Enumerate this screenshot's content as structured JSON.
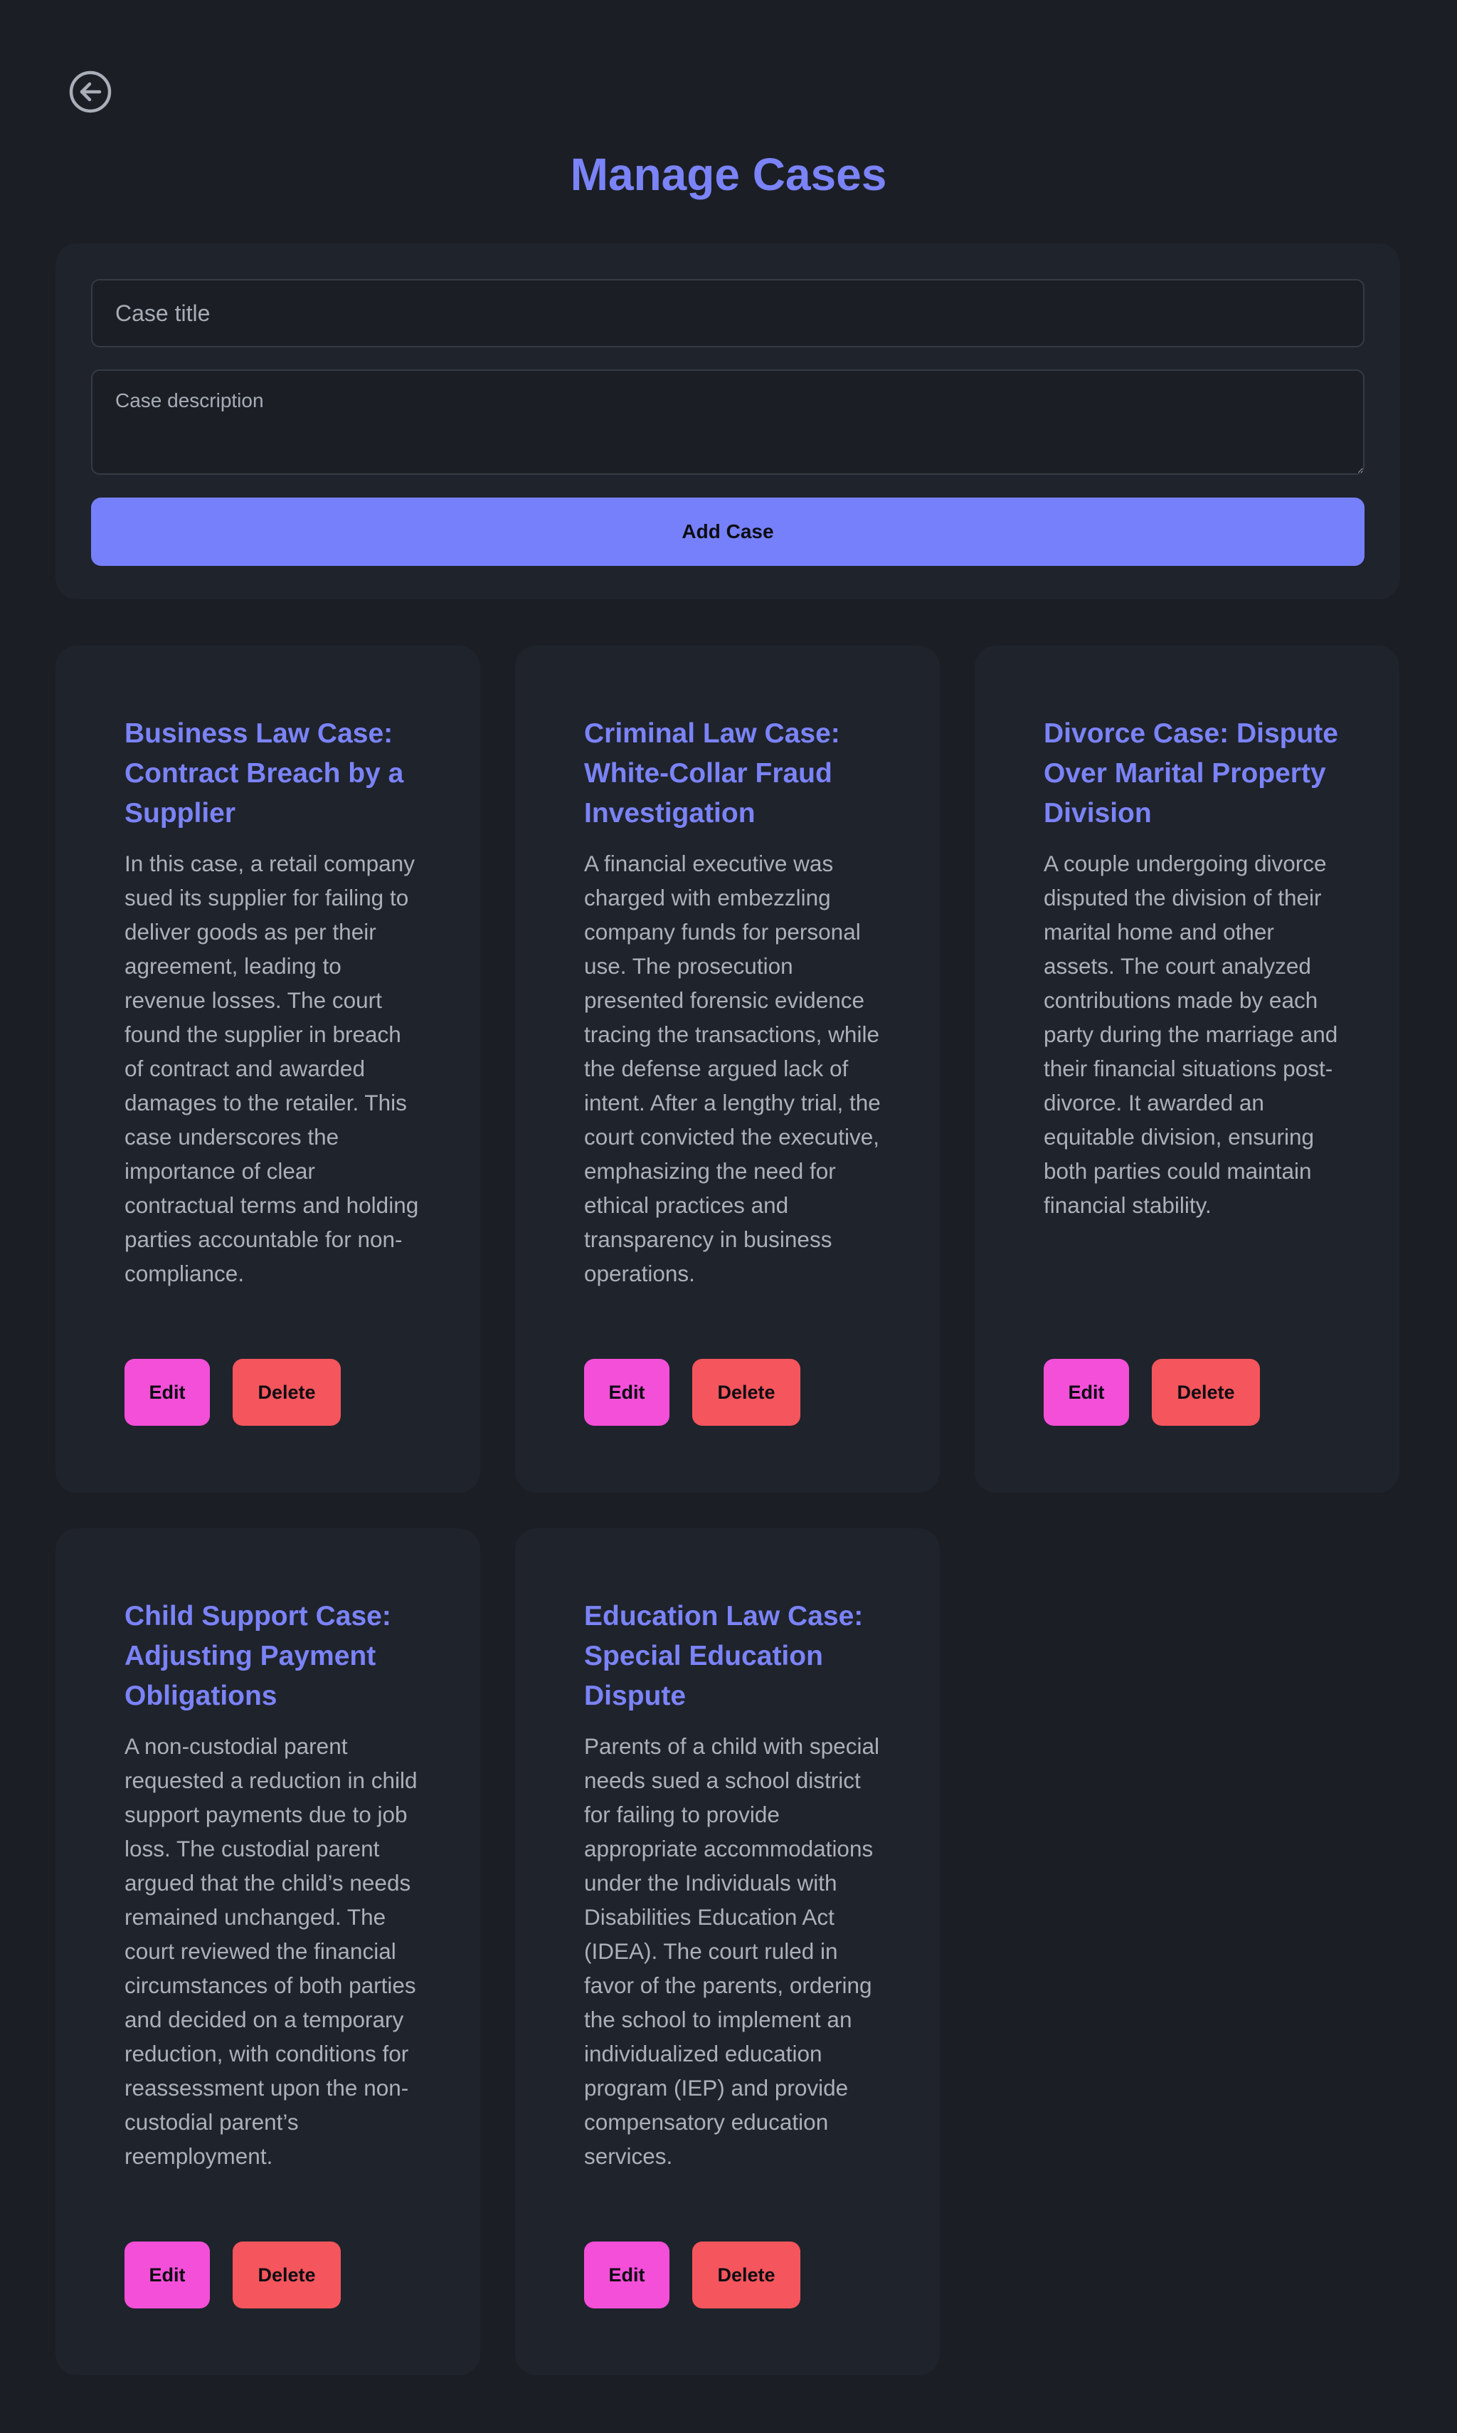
{
  "header": {
    "back_icon": "arrow-left-circle-icon",
    "title": "Manage Cases"
  },
  "form": {
    "title_placeholder": "Case title",
    "description_placeholder": "Case description",
    "add_label": "Add Case"
  },
  "colors": {
    "background": "#1b1e24",
    "panel": "#1f232b",
    "accent": "#7b83f8",
    "add_button": "#7780fb",
    "edit_button": "#f44fd9",
    "delete_button": "#f5555c",
    "body_text": "#acb0b9"
  },
  "cases": [
    {
      "title": "Business Law Case: Contract Breach by a Supplier",
      "description": "In this case, a retail company sued its supplier for failing to deliver goods as per their agreement, leading to revenue losses. The court found the supplier in breach of contract and awarded damages to the retailer. This case underscores the importance of clear contractual terms and holding parties accountable for non-compliance.",
      "edit_label": "Edit",
      "delete_label": "Delete"
    },
    {
      "title": "Criminal Law Case: White-Collar Fraud Investigation",
      "description": "A financial executive was charged with embezzling company funds for personal use. The prosecution presented forensic evidence tracing the transactions, while the defense argued lack of intent. After a lengthy trial, the court convicted the executive, emphasizing the need for ethical practices and transparency in business operations.",
      "edit_label": "Edit",
      "delete_label": "Delete"
    },
    {
      "title": "Divorce Case: Dispute Over Marital Property Division",
      "description": "A couple undergoing divorce disputed the division of their marital home and other assets. The court analyzed contributions made by each party during the marriage and their financial situations post-divorce. It awarded an equitable division, ensuring both parties could maintain financial stability.",
      "edit_label": "Edit",
      "delete_label": "Delete"
    },
    {
      "title": "Child Support Case: Adjusting Payment Obligations",
      "description": "A non-custodial parent requested a reduction in child support payments due to job loss. The custodial parent argued that the child’s needs remained unchanged. The court reviewed the financial circumstances of both parties and decided on a temporary reduction, with conditions for reassessment upon the non-custodial parent’s reemployment.",
      "edit_label": "Edit",
      "delete_label": "Delete"
    },
    {
      "title": "Education Law Case: Special Education Dispute",
      "description": "Parents of a child with special needs sued a school district for failing to provide appropriate accommodations under the Individuals with Disabilities Education Act (IDEA). The court ruled in favor of the parents, ordering the school to implement an individualized education program (IEP) and provide compensatory education services.",
      "edit_label": "Edit",
      "delete_label": "Delete"
    }
  ]
}
